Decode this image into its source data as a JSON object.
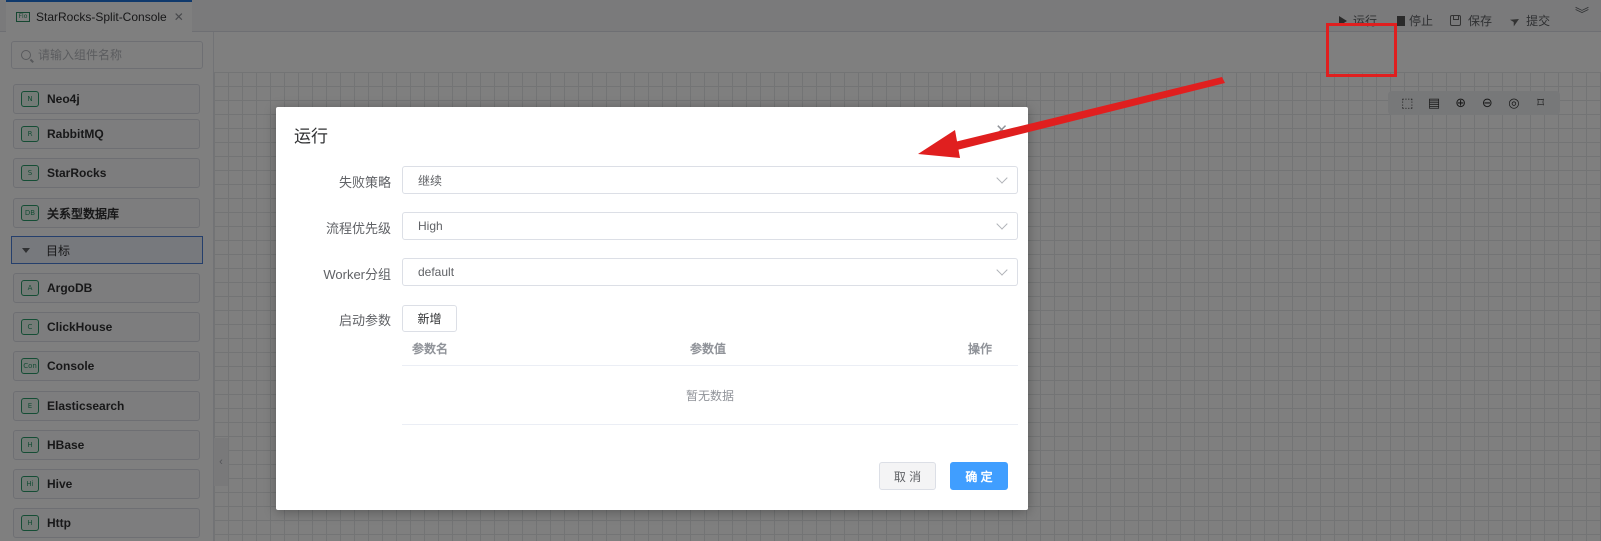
{
  "tab": {
    "icon_text": "Flo",
    "title": "StarRocks-Split-Console"
  },
  "sidebar": {
    "search_placeholder": "请输入组件名称",
    "items": [
      {
        "label": "Neo4j",
        "icon": "neo4j-icon",
        "icon_text": "N"
      },
      {
        "label": "RabbitMQ",
        "icon": "rabbitmq-icon",
        "icon_text": "R"
      },
      {
        "label": "StarRocks",
        "icon": "starrocks-icon",
        "icon_text": "S"
      },
      {
        "label": "关系型数据库",
        "icon": "rdb-icon",
        "icon_text": "DB"
      }
    ],
    "group": {
      "label": "目标"
    },
    "targets": [
      {
        "label": "ArgoDB",
        "icon": "argodb-icon",
        "icon_text": "A"
      },
      {
        "label": "ClickHouse",
        "icon": "clickhouse-icon",
        "icon_text": "C"
      },
      {
        "label": "Console",
        "icon": "console-icon",
        "icon_text": "Con"
      },
      {
        "label": "Elasticsearch",
        "icon": "elasticsearch-icon",
        "icon_text": "E"
      },
      {
        "label": "HBase",
        "icon": "hbase-icon",
        "icon_text": "H"
      },
      {
        "label": "Hive",
        "icon": "hive-icon",
        "icon_text": "Hi"
      },
      {
        "label": "Http",
        "icon": "http-icon",
        "icon_text": "H"
      }
    ]
  },
  "toolbar": {
    "run_label": "运行",
    "stop_label": "停止",
    "save_label": "保存",
    "submit_label": "提交"
  },
  "dialog": {
    "title": "运行",
    "fields": {
      "fail_strategy": {
        "label": "失败策略",
        "value": "继续"
      },
      "priority": {
        "label": "流程优先级",
        "value": "High"
      },
      "worker_group": {
        "label": "Worker分组",
        "value": "default"
      },
      "startup_params": {
        "label": "启动参数",
        "add_label": "新增"
      }
    },
    "table": {
      "columns": [
        "参数名",
        "参数值",
        "操作"
      ],
      "empty_text": "暂无数据"
    },
    "cancel_label": "取 消",
    "confirm_label": "确 定"
  },
  "annotation": {
    "highlight_color": "#e01f1f"
  },
  "colors": {
    "primary": "#409eff",
    "accent_tab": "#1f72d8",
    "icon_green": "#2b9a6a"
  }
}
